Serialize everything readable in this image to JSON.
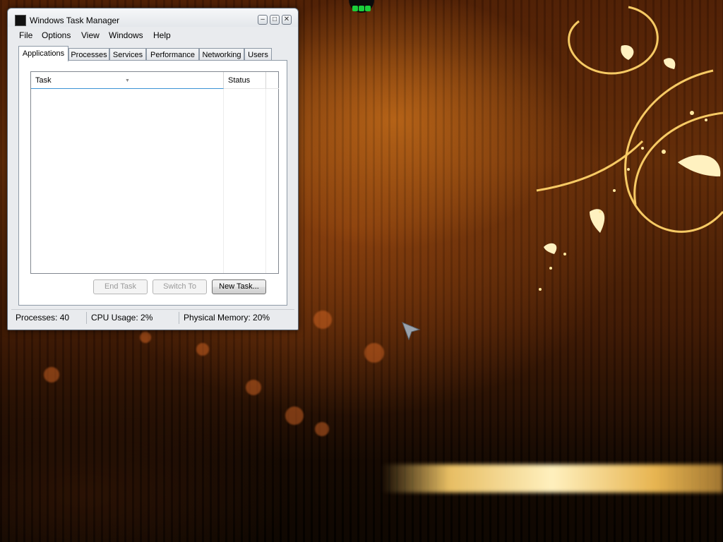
{
  "window": {
    "title": "Windows Task Manager",
    "minimize_glyph": "–",
    "maximize_glyph": "□",
    "close_glyph": "✕"
  },
  "menu": [
    "File",
    "Options",
    "View",
    "Windows",
    "Help"
  ],
  "tabs": [
    {
      "label": "Applications",
      "active": true
    },
    {
      "label": "Processes",
      "active": false
    },
    {
      "label": "Services",
      "active": false
    },
    {
      "label": "Performance",
      "active": false
    },
    {
      "label": "Networking",
      "active": false
    },
    {
      "label": "Users",
      "active": false
    }
  ],
  "list": {
    "columns": [
      "Task",
      "Status"
    ],
    "rows": []
  },
  "buttons": {
    "end_task": "End Task",
    "switch_to": "Switch To",
    "new_task": "New Task..."
  },
  "status_bar": {
    "processes": "Processes: 40",
    "cpu": "CPU Usage: 2%",
    "memory": "Physical Memory: 20%"
  },
  "icons": {
    "app": "task-manager-icon",
    "cursor": "arrow-cursor-icon"
  },
  "colors": {
    "accent": "#3b93d6",
    "indicator": "#1bcf3b"
  }
}
